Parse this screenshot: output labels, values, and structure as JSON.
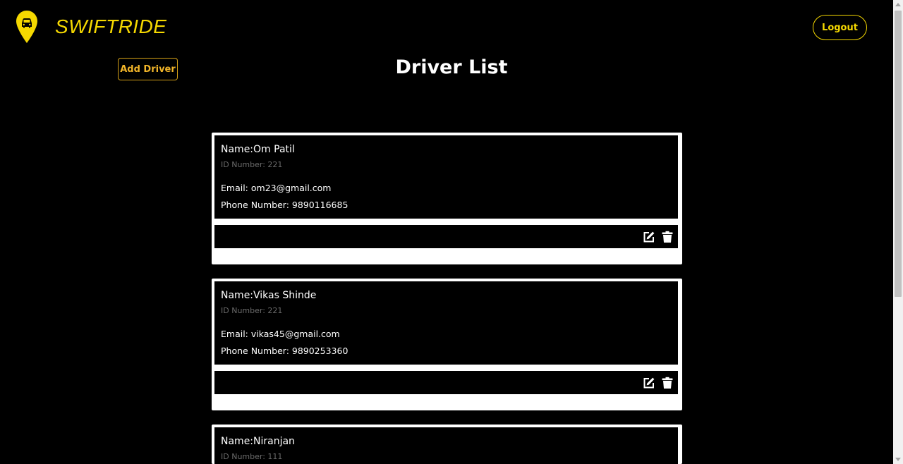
{
  "header": {
    "brand": "SWIFTRIDE",
    "logout_label": "Logout",
    "logo_icon": "car-location-pin-icon"
  },
  "toolbar": {
    "add_driver_label": "Add Driver"
  },
  "page": {
    "title": "Driver List"
  },
  "drivers": [
    {
      "name": "Name:Om Patil",
      "id": "ID Number: 221",
      "email": "Email: om23@gmail.com",
      "phone": "Phone Number: 9890116685"
    },
    {
      "name": "Name:Vikas Shinde",
      "id": "ID Number: 221",
      "email": "Email: vikas45@gmail.com",
      "phone": "Phone Number: 9890253360"
    },
    {
      "name": "Name:Niranjan",
      "id": "ID Number: 111"
    }
  ],
  "icons": {
    "edit": "edit-icon",
    "delete": "trash-icon"
  },
  "colors": {
    "brand": "#f5d800",
    "accent": "#f0b429",
    "background": "#000000"
  }
}
